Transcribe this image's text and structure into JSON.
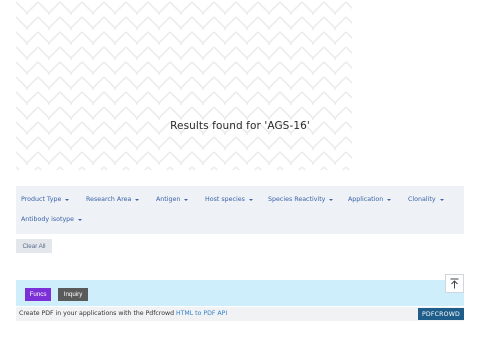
{
  "hero": {
    "title": "Results found for 'AGS-16'"
  },
  "filters": [
    {
      "label": "Product Type"
    },
    {
      "label": "Research Area"
    },
    {
      "label": "Antigen"
    },
    {
      "label": "Host species"
    },
    {
      "label": "Species Reactivity"
    },
    {
      "label": "Application"
    },
    {
      "label": "Clonality"
    },
    {
      "label": "Antibody isotype"
    }
  ],
  "clear_label": "Clear All",
  "widget": {
    "funcs_label": "Funcs",
    "inquiry_label": "Inquiry"
  },
  "pdfcrowd": {
    "text": "Create PDF in your applications with the Pdfcrowd ",
    "link": "HTML to PDF API",
    "button": "PDFCROWD"
  },
  "colors": {
    "accent": "#3b63a8",
    "funcs": "#7b2fd6",
    "pdf_button": "#1f5e8a",
    "widget_bg": "#cdeefa"
  },
  "icons": {
    "scroll_top": "arrow-up-icon"
  }
}
